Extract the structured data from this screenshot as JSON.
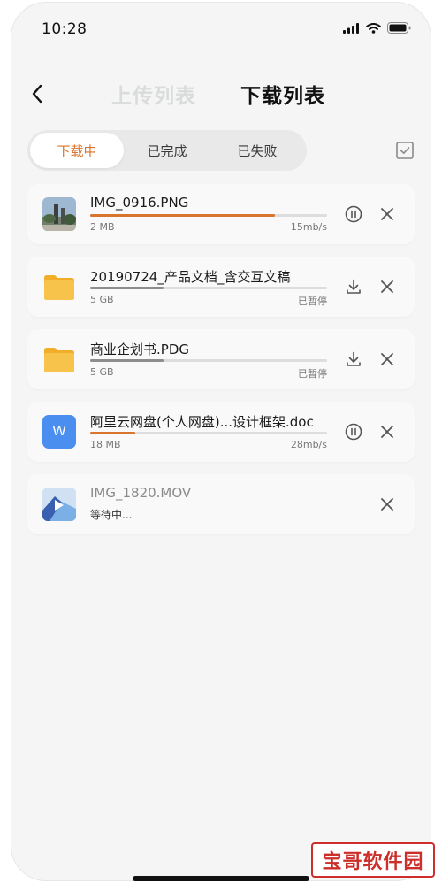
{
  "status": {
    "time": "10:28"
  },
  "header": {
    "upload_tab": "上传列表",
    "download_tab": "下载列表"
  },
  "filters": {
    "downloading": "下载中",
    "completed": "已完成",
    "failed": "已失败",
    "active": "下载中"
  },
  "colors": {
    "accent": "#d9742e",
    "paused_bar": "#8d8d8d",
    "doc_icon": "#4a8ef0",
    "folder": "#f7bf3d"
  },
  "items": [
    {
      "name": "IMG_0916.PNG",
      "size": "2 MB",
      "status": "15mb/s",
      "progress": 0.78,
      "state": "downloading",
      "icon": "photo-thumbnail-icon"
    },
    {
      "name": "20190724_产品文档_含交互文稿",
      "size": "5 GB",
      "status": "已暂停",
      "progress": 0.31,
      "state": "paused",
      "icon": "folder-icon"
    },
    {
      "name": "商业企划书.PDG",
      "size": "5 GB",
      "status": "已暂停",
      "progress": 0.31,
      "state": "paused",
      "icon": "folder-icon"
    },
    {
      "name": "阿里云网盘(个人网盘)...设计框架.doc",
      "size": "18 MB",
      "status": "28mb/s",
      "progress": 0.19,
      "state": "downloading",
      "icon": "word-doc-icon",
      "icon_letter": "W"
    },
    {
      "name": "IMG_1820.MOV",
      "size": "",
      "status": "等待中...",
      "state": "waiting",
      "icon": "video-thumbnail-icon"
    }
  ],
  "watermark": {
    "text": "宝哥软件园"
  }
}
